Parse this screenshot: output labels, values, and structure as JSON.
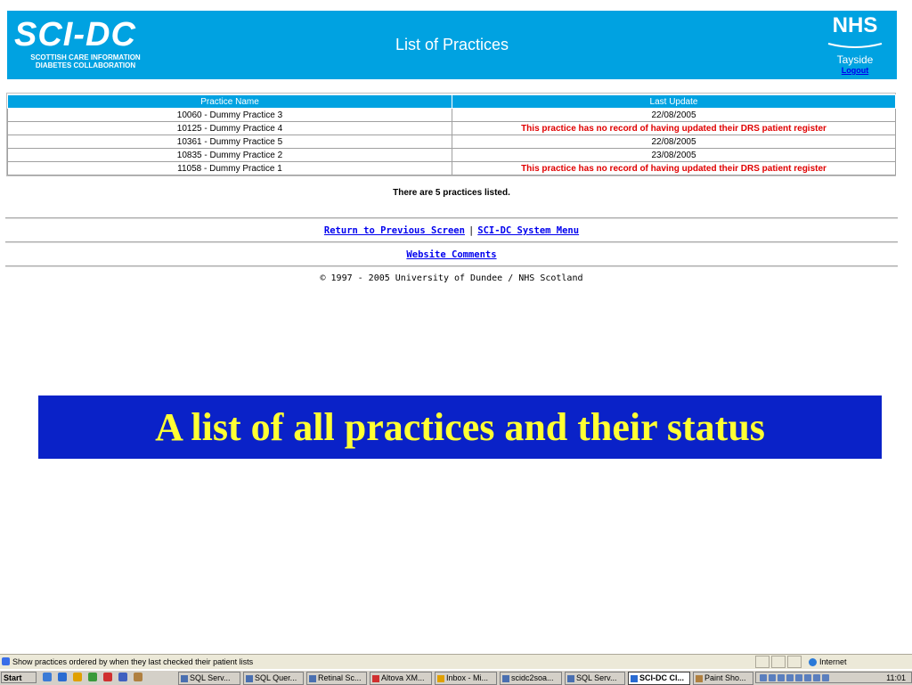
{
  "header": {
    "logo_main": "SCI-DC",
    "logo_sub_1": "SCOTTISH CARE INFORMATION",
    "logo_sub_2": "DIABETES COLLABORATION",
    "title": "List of Practices",
    "nhs_word": "NHS",
    "nhs_region": "Tayside",
    "logout": "Logout"
  },
  "table": {
    "columns": [
      "Practice Name",
      "Last Update"
    ],
    "rows": [
      {
        "name": "10060 - Dummy Practice 3",
        "update": "22/08/2005",
        "warn": false
      },
      {
        "name": "10125 - Dummy Practice 4",
        "update": "This practice has no record of having updated their DRS patient register",
        "warn": true
      },
      {
        "name": "10361 - Dummy Practice 5",
        "update": "22/08/2005",
        "warn": false
      },
      {
        "name": "10835 - Dummy Practice 2",
        "update": "23/08/2005",
        "warn": false
      },
      {
        "name": "11058 - Dummy Practice 1",
        "update": "This practice has no record of having updated their DRS patient register",
        "warn": true
      }
    ]
  },
  "summary": "There are 5 practices listed.",
  "nav": {
    "return": "Return to Previous Screen",
    "separator": "|",
    "system_menu": "SCI-DC System Menu",
    "comments": "Website Comments"
  },
  "copyright": "© 1997 - 2005 University of Dundee / NHS Scotland",
  "caption": "A list of all practices and their status",
  "status_bar": {
    "text": "Show practices ordered by when they last checked their patient lists",
    "zone": "Internet"
  },
  "taskbar": {
    "start": "Start",
    "tasks": [
      {
        "label": "SQL Serv...",
        "active": false
      },
      {
        "label": "SQL Quer...",
        "active": false
      },
      {
        "label": "Retinal Sc...",
        "active": false
      },
      {
        "label": "Altova XM...",
        "active": false
      },
      {
        "label": "Inbox - Mi...",
        "active": false
      },
      {
        "label": "scidc2soa...",
        "active": false
      },
      {
        "label": "SQL Serv...",
        "active": false
      },
      {
        "label": "SCI-DC Cl...",
        "active": true
      },
      {
        "label": "Paint Sho...",
        "active": false
      }
    ],
    "clock": "11:01"
  },
  "colors": {
    "banner": "#00a2e1",
    "caption_bg": "#0a22c8",
    "caption_text": "#ffff33",
    "warning": "#e00000",
    "link": "#0000ee"
  }
}
